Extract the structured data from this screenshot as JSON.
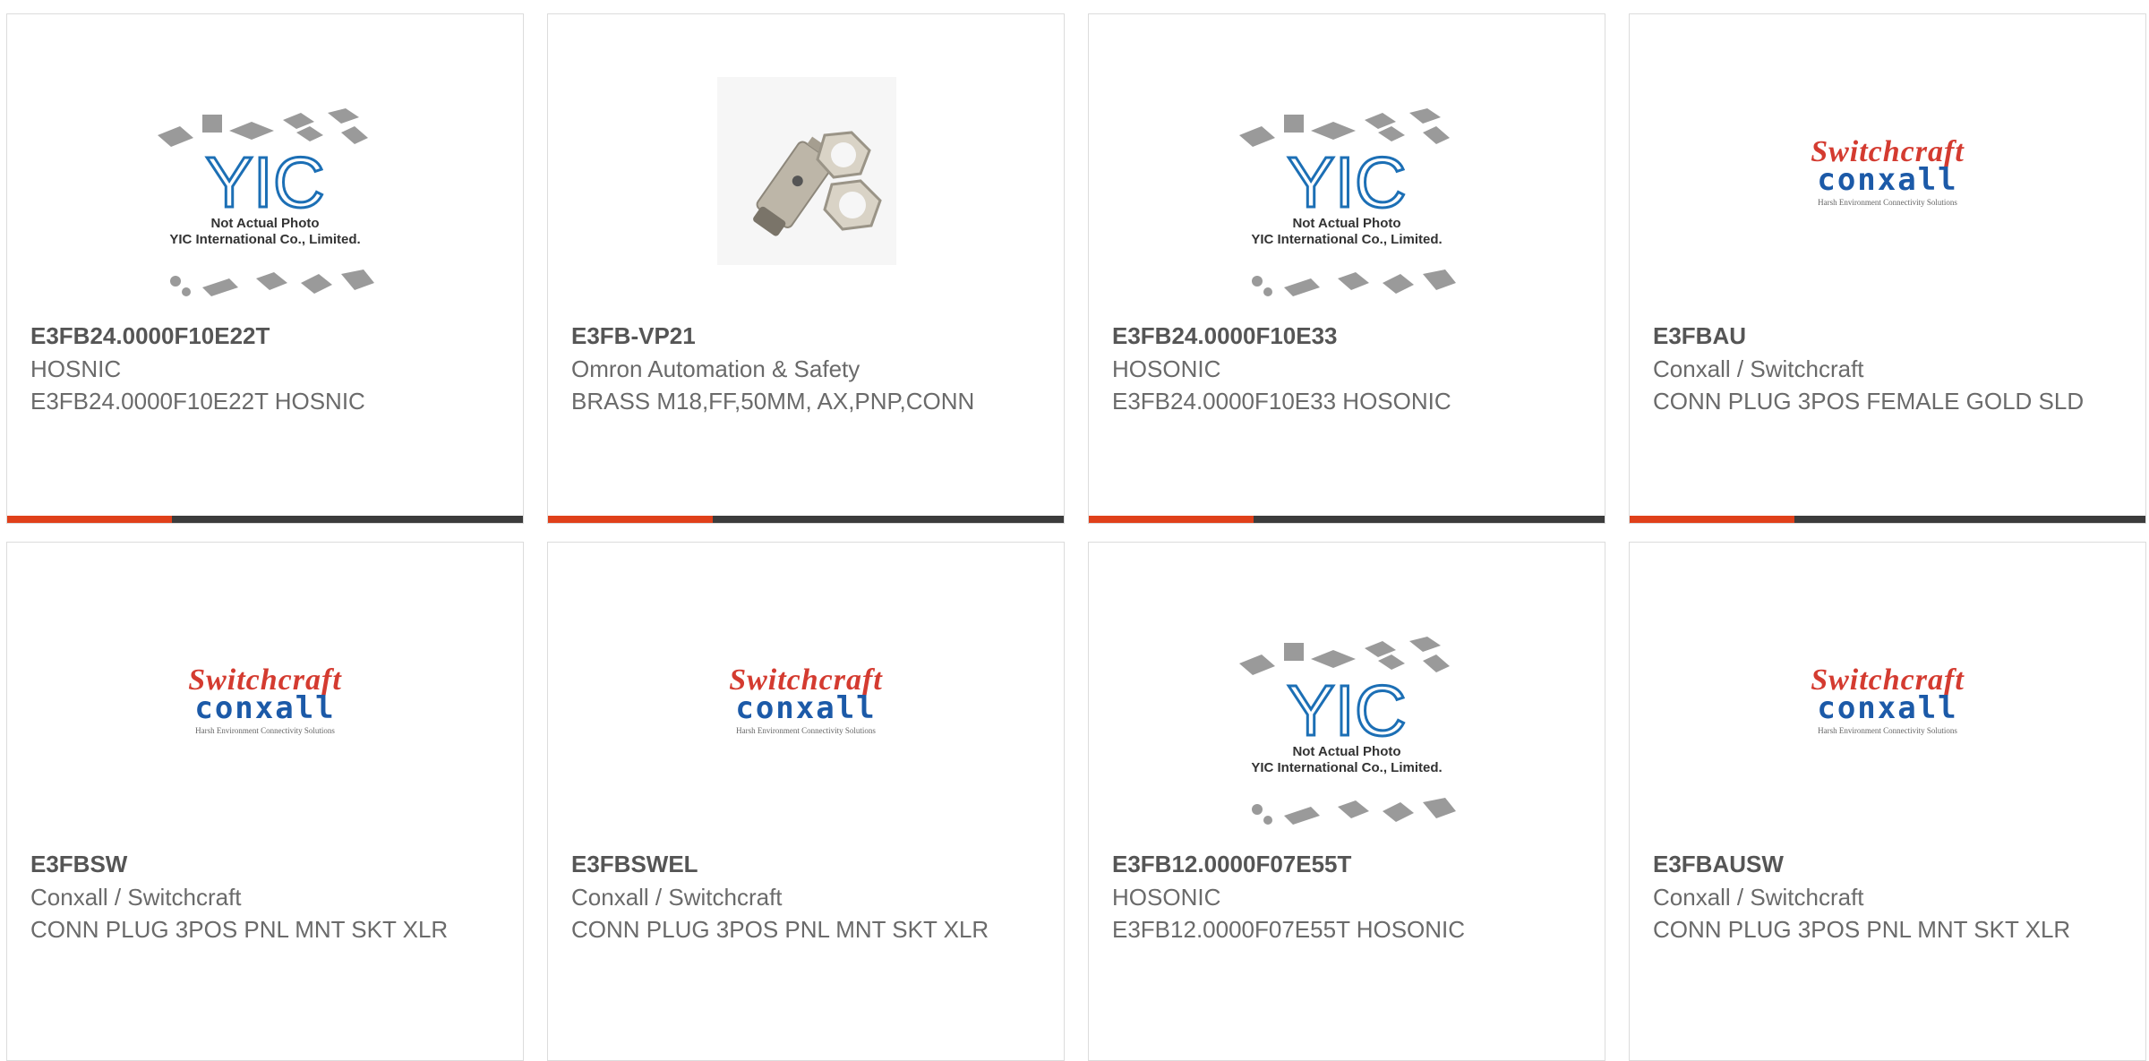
{
  "colors": {
    "accent": "#e0401a",
    "bar": "#3c3c3c",
    "border": "#dcdcdc"
  },
  "placeholder": {
    "brand": "YIC",
    "line1": "Not Actual Photo",
    "line2": "YIC International Co., Limited."
  },
  "switchcraft_logo": {
    "top": "Switchcraft",
    "mid": "conxall",
    "tag": "Harsh Environment Connectivity Solutions"
  },
  "products": [
    {
      "part": "E3FB24.0000F10E22T",
      "manufacturer": "HOSNIC",
      "description": "E3FB24.0000F10E22T HOSNIC",
      "image": "yic-placeholder"
    },
    {
      "part": "E3FB-VP21",
      "manufacturer": "Omron Automation & Safety",
      "description": "BRASS M18,FF,50MM, AX,PNP,CONN",
      "image": "sensor-photo"
    },
    {
      "part": "E3FB24.0000F10E33",
      "manufacturer": "HOSONIC",
      "description": "E3FB24.0000F10E33 HOSONIC",
      "image": "yic-placeholder"
    },
    {
      "part": "E3FBAU",
      "manufacturer": "Conxall / Switchcraft",
      "description": "CONN PLUG 3POS FEMALE GOLD SLD",
      "image": "switchcraft-logo"
    },
    {
      "part": "E3FBSW",
      "manufacturer": "Conxall / Switchcraft",
      "description": "CONN PLUG 3POS PNL MNT SKT XLR",
      "image": "switchcraft-logo"
    },
    {
      "part": "E3FBSWEL",
      "manufacturer": "Conxall / Switchcraft",
      "description": "CONN PLUG 3POS PNL MNT SKT XLR",
      "image": "switchcraft-logo"
    },
    {
      "part": "E3FB12.0000F07E55T",
      "manufacturer": "HOSONIC",
      "description": "E3FB12.0000F07E55T HOSONIC",
      "image": "yic-placeholder"
    },
    {
      "part": "E3FBAUSW",
      "manufacturer": "Conxall / Switchcraft",
      "description": "CONN PLUG 3POS PNL MNT SKT XLR",
      "image": "switchcraft-logo"
    }
  ]
}
